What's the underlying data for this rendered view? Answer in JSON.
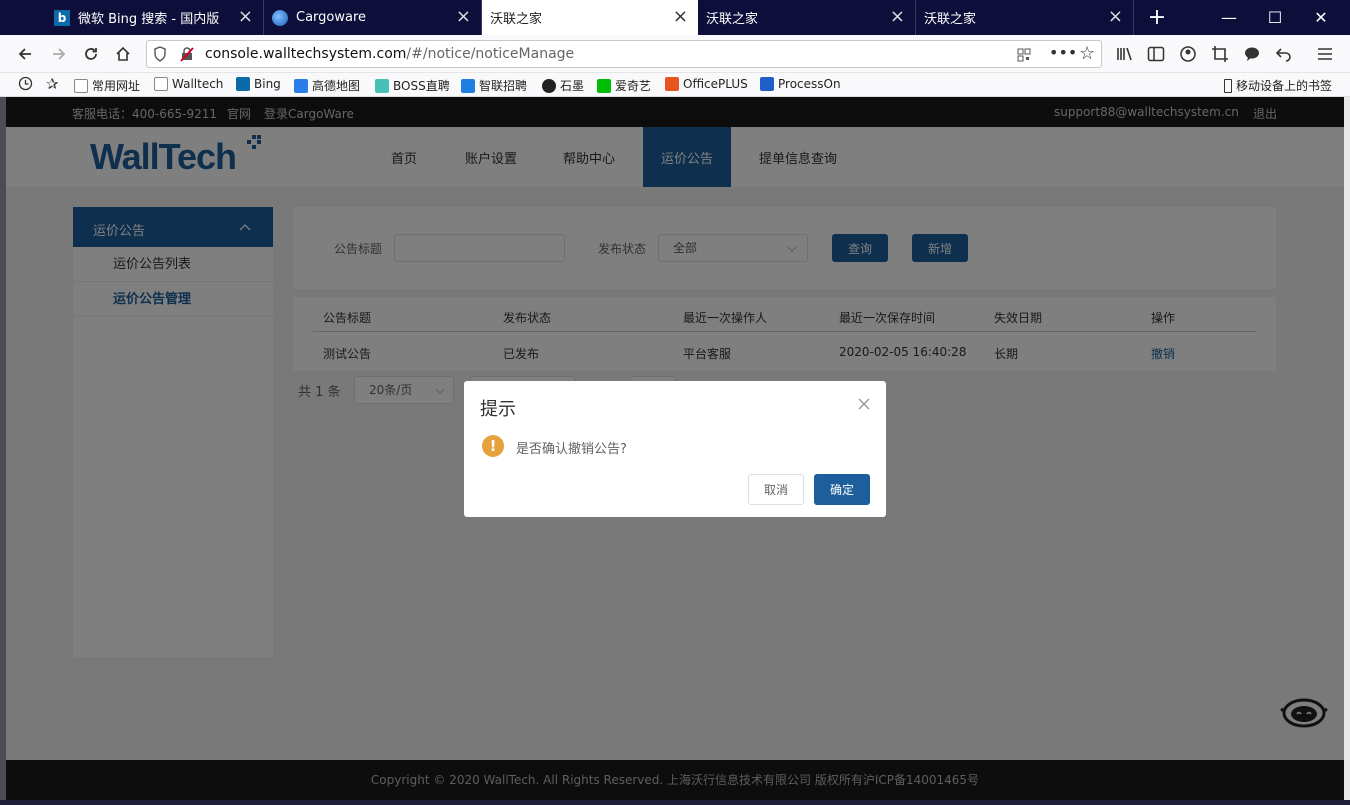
{
  "tabs": [
    {
      "label": "微软 Bing 搜索 - 国内版",
      "icon": "bing-icon"
    },
    {
      "label": "Cargoware",
      "icon": "globe-icon"
    },
    {
      "label": "沃联之家",
      "icon": "",
      "active": true
    },
    {
      "label": "沃联之家",
      "icon": ""
    },
    {
      "label": "沃联之家",
      "icon": ""
    }
  ],
  "browser": {
    "url_domain": "console.walltechsystem.com",
    "url_path": "/#/notice/noticeManage",
    "new_tab": "+",
    "minimize": "—",
    "maximize": "☐",
    "close": "✕"
  },
  "bookmarks": [
    {
      "label": "常用网址",
      "color": "#999999"
    },
    {
      "label": "Walltech",
      "color": "#999999"
    },
    {
      "label": "Bing",
      "color": "#0a6ba8"
    },
    {
      "label": "高德地图",
      "color": "#2b7de9"
    },
    {
      "label": "BOSS直聘",
      "color": "#48c0b5"
    },
    {
      "label": "智联招聘",
      "color": "#1f7fe0"
    },
    {
      "label": "石墨",
      "color": "#222222"
    },
    {
      "label": "爱奇艺",
      "color": "#00be06"
    },
    {
      "label": "OfficePLUS",
      "color": "#e8541f"
    },
    {
      "label": "ProcessOn",
      "color": "#1f60c8"
    }
  ],
  "mobile_bookmarks": "移动设备上的书签",
  "topstrip": {
    "phone": "客服电话：400-665-9211",
    "site": "官网",
    "login": "登录CargoWare",
    "email": "support88@walltechsystem.cn",
    "logout": "退出"
  },
  "logo": "WallTech",
  "nav": [
    "首页",
    "账户设置",
    "帮助中心",
    "运价公告",
    "提单信息查询"
  ],
  "sidebar": {
    "header": "运价公告",
    "items": [
      "运价公告列表",
      "运价公告管理"
    ]
  },
  "search": {
    "title_label": "公告标题",
    "title_value": "",
    "status_label": "发布状态",
    "status_value": "全部",
    "query_button": "查询",
    "add_button": "新增"
  },
  "table": {
    "headers": [
      "公告标题",
      "发布状态",
      "最近一次操作人",
      "最近一次保存时间",
      "失效日期",
      "操作"
    ],
    "rows": [
      [
        "测试公告",
        "已发布",
        "平台客服",
        "2020-02-05 16:40:28",
        "长期",
        "撤销"
      ]
    ]
  },
  "pager": {
    "total": "共 1 条",
    "size": "20条/页"
  },
  "dialog": {
    "title": "提示",
    "message": "是否确认撤销公告?",
    "cancel": "取消",
    "confirm": "确定"
  },
  "footer": "Copyright © 2020 WallTech. All Rights Reserved. 上海沃行信息技术有限公司 版权所有沪ICP备14001465号",
  "colors": {
    "brand": "#1d5e9c",
    "warning": "#e6a23c",
    "tabbar": "#0e0e3a"
  }
}
